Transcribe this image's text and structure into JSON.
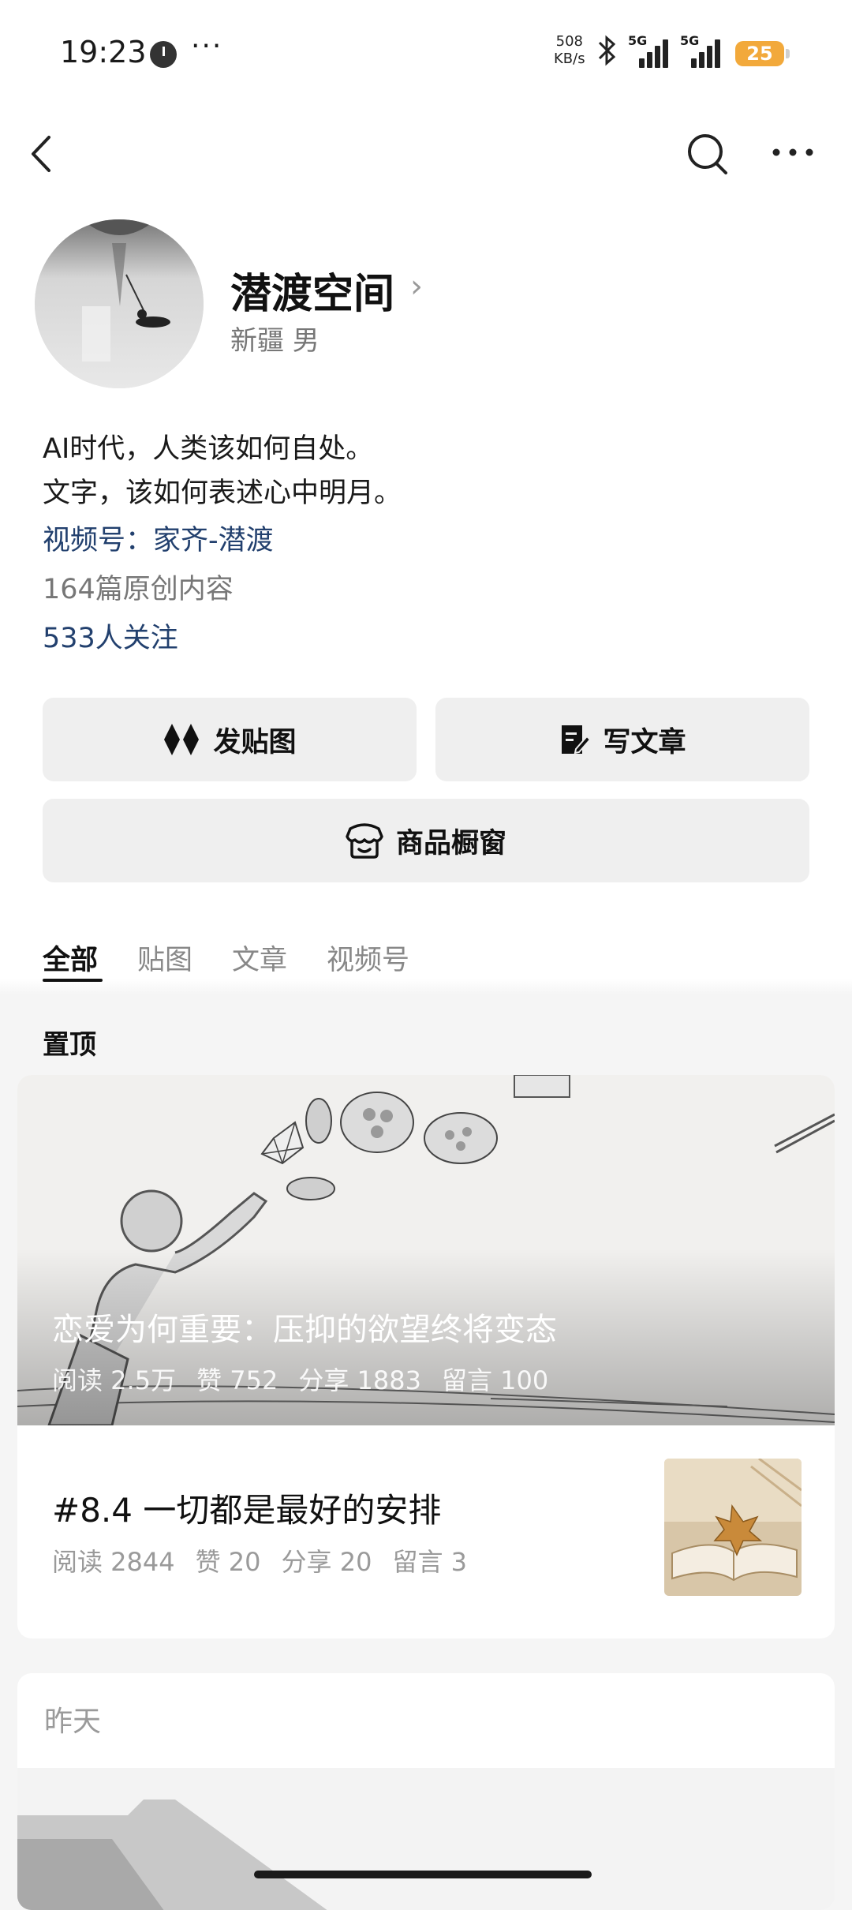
{
  "status_bar": {
    "time": "19:23",
    "dots": "···",
    "net_speed_value": "508",
    "net_speed_unit": "KB/s",
    "signal1_label": "5G",
    "signal2_label": "5G",
    "battery": "25",
    "icons": [
      "clock-icon",
      "bluetooth-icon",
      "signal-icon",
      "signal-icon",
      "battery-icon"
    ]
  },
  "nav": {
    "icons": [
      "back-arrow-icon",
      "search-icon",
      "more-icon"
    ]
  },
  "profile": {
    "name": "潜渡空间",
    "sub": "新疆 男",
    "bio_line1": "AI时代，人类该如何自处。",
    "bio_line2": "文字，该如何表述心中明月。",
    "video_channel": "视频号：家齐-潜渡",
    "article_count": "164篇原创内容",
    "followers": "533人关注"
  },
  "actions": {
    "post_image": "发贴图",
    "write_article": "写文章",
    "shop_window": "商品橱窗"
  },
  "tabs": [
    {
      "label": "全部",
      "active": true
    },
    {
      "label": "贴图",
      "active": false
    },
    {
      "label": "文章",
      "active": false
    },
    {
      "label": "视频号",
      "active": false
    }
  ],
  "pinned_section": "置顶",
  "pinned_article": {
    "title": "恋爱为何重要：压抑的欲望终将变态",
    "reads": "阅读 2.5万",
    "likes": "赞 752",
    "shares": "分享 1883",
    "comments": "留言 100"
  },
  "second_article": {
    "title": "#8.4  一切都是最好的安排",
    "reads": "阅读 2844",
    "likes": "赞 20",
    "shares": "分享 20",
    "comments": "留言 3"
  },
  "yesterday_label": "昨天",
  "colors": {
    "link": "#22406e",
    "battery": "#f2a93b",
    "button_bg": "#efefef"
  }
}
